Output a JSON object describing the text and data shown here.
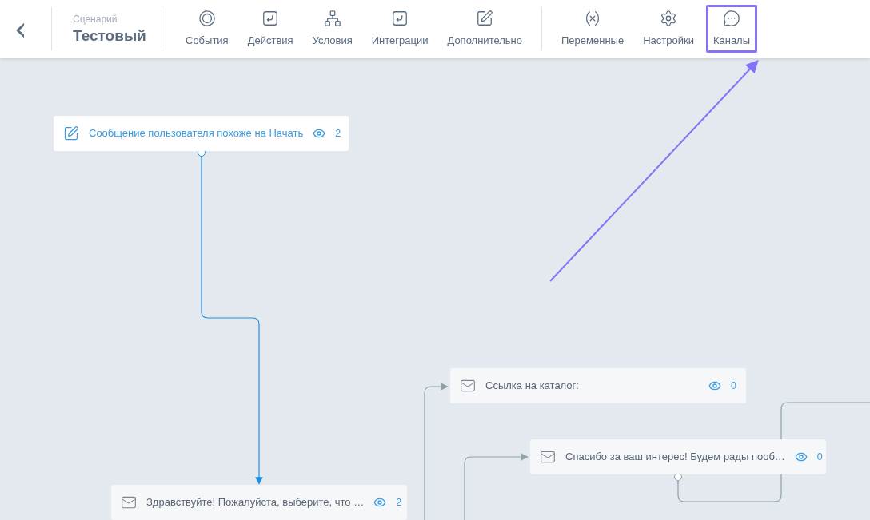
{
  "header": {
    "back_button": "‹",
    "scenario_label": "Сценарий",
    "scenario_name": "Тестовый"
  },
  "tools": [
    {
      "kind": "events",
      "label": "События",
      "highlighted": false
    },
    {
      "kind": "actions",
      "label": "Действия",
      "highlighted": false
    },
    {
      "kind": "conditions",
      "label": "Условия",
      "highlighted": false
    },
    {
      "kind": "integrations",
      "label": "Интеграции",
      "highlighted": false
    },
    {
      "kind": "extra",
      "label": "Дополнительно",
      "highlighted": false
    },
    {
      "kind": "divider"
    },
    {
      "kind": "variables",
      "label": "Переменные",
      "highlighted": false
    },
    {
      "kind": "settings",
      "label": "Настройки",
      "highlighted": false
    },
    {
      "kind": "channels",
      "label": "Каналы",
      "highlighted": true
    }
  ],
  "nodes": [
    {
      "kind": "trigger",
      "text": "Сообщение пользователя похоже на Начать",
      "views": "2"
    },
    {
      "kind": "message",
      "text": "Ссылка на каталог:",
      "views": "0"
    },
    {
      "kind": "message",
      "text": "Спасибо за ваш интерес! Будем рады пооб…",
      "views": "0"
    },
    {
      "kind": "message",
      "text": "Здравствуйте! Пожалуйста, выберите, что …",
      "views": "2"
    }
  ]
}
